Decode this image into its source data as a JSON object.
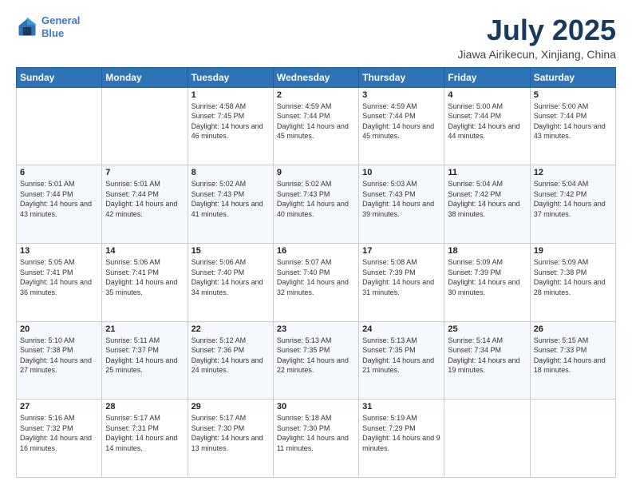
{
  "logo": {
    "line1": "General",
    "line2": "Blue"
  },
  "title": "July 2025",
  "subtitle": "Jiawa Airikecun, Xinjiang, China",
  "days": [
    "Sunday",
    "Monday",
    "Tuesday",
    "Wednesday",
    "Thursday",
    "Friday",
    "Saturday"
  ],
  "weeks": [
    [
      {
        "day": "",
        "sunrise": "",
        "sunset": "",
        "daylight": ""
      },
      {
        "day": "",
        "sunrise": "",
        "sunset": "",
        "daylight": ""
      },
      {
        "day": "1",
        "sunrise": "Sunrise: 4:58 AM",
        "sunset": "Sunset: 7:45 PM",
        "daylight": "Daylight: 14 hours and 46 minutes."
      },
      {
        "day": "2",
        "sunrise": "Sunrise: 4:59 AM",
        "sunset": "Sunset: 7:44 PM",
        "daylight": "Daylight: 14 hours and 45 minutes."
      },
      {
        "day": "3",
        "sunrise": "Sunrise: 4:59 AM",
        "sunset": "Sunset: 7:44 PM",
        "daylight": "Daylight: 14 hours and 45 minutes."
      },
      {
        "day": "4",
        "sunrise": "Sunrise: 5:00 AM",
        "sunset": "Sunset: 7:44 PM",
        "daylight": "Daylight: 14 hours and 44 minutes."
      },
      {
        "day": "5",
        "sunrise": "Sunrise: 5:00 AM",
        "sunset": "Sunset: 7:44 PM",
        "daylight": "Daylight: 14 hours and 43 minutes."
      }
    ],
    [
      {
        "day": "6",
        "sunrise": "Sunrise: 5:01 AM",
        "sunset": "Sunset: 7:44 PM",
        "daylight": "Daylight: 14 hours and 43 minutes."
      },
      {
        "day": "7",
        "sunrise": "Sunrise: 5:01 AM",
        "sunset": "Sunset: 7:44 PM",
        "daylight": "Daylight: 14 hours and 42 minutes."
      },
      {
        "day": "8",
        "sunrise": "Sunrise: 5:02 AM",
        "sunset": "Sunset: 7:43 PM",
        "daylight": "Daylight: 14 hours and 41 minutes."
      },
      {
        "day": "9",
        "sunrise": "Sunrise: 5:02 AM",
        "sunset": "Sunset: 7:43 PM",
        "daylight": "Daylight: 14 hours and 40 minutes."
      },
      {
        "day": "10",
        "sunrise": "Sunrise: 5:03 AM",
        "sunset": "Sunset: 7:43 PM",
        "daylight": "Daylight: 14 hours and 39 minutes."
      },
      {
        "day": "11",
        "sunrise": "Sunrise: 5:04 AM",
        "sunset": "Sunset: 7:42 PM",
        "daylight": "Daylight: 14 hours and 38 minutes."
      },
      {
        "day": "12",
        "sunrise": "Sunrise: 5:04 AM",
        "sunset": "Sunset: 7:42 PM",
        "daylight": "Daylight: 14 hours and 37 minutes."
      }
    ],
    [
      {
        "day": "13",
        "sunrise": "Sunrise: 5:05 AM",
        "sunset": "Sunset: 7:41 PM",
        "daylight": "Daylight: 14 hours and 36 minutes."
      },
      {
        "day": "14",
        "sunrise": "Sunrise: 5:06 AM",
        "sunset": "Sunset: 7:41 PM",
        "daylight": "Daylight: 14 hours and 35 minutes."
      },
      {
        "day": "15",
        "sunrise": "Sunrise: 5:06 AM",
        "sunset": "Sunset: 7:40 PM",
        "daylight": "Daylight: 14 hours and 34 minutes."
      },
      {
        "day": "16",
        "sunrise": "Sunrise: 5:07 AM",
        "sunset": "Sunset: 7:40 PM",
        "daylight": "Daylight: 14 hours and 32 minutes."
      },
      {
        "day": "17",
        "sunrise": "Sunrise: 5:08 AM",
        "sunset": "Sunset: 7:39 PM",
        "daylight": "Daylight: 14 hours and 31 minutes."
      },
      {
        "day": "18",
        "sunrise": "Sunrise: 5:09 AM",
        "sunset": "Sunset: 7:39 PM",
        "daylight": "Daylight: 14 hours and 30 minutes."
      },
      {
        "day": "19",
        "sunrise": "Sunrise: 5:09 AM",
        "sunset": "Sunset: 7:38 PM",
        "daylight": "Daylight: 14 hours and 28 minutes."
      }
    ],
    [
      {
        "day": "20",
        "sunrise": "Sunrise: 5:10 AM",
        "sunset": "Sunset: 7:38 PM",
        "daylight": "Daylight: 14 hours and 27 minutes."
      },
      {
        "day": "21",
        "sunrise": "Sunrise: 5:11 AM",
        "sunset": "Sunset: 7:37 PM",
        "daylight": "Daylight: 14 hours and 25 minutes."
      },
      {
        "day": "22",
        "sunrise": "Sunrise: 5:12 AM",
        "sunset": "Sunset: 7:36 PM",
        "daylight": "Daylight: 14 hours and 24 minutes."
      },
      {
        "day": "23",
        "sunrise": "Sunrise: 5:13 AM",
        "sunset": "Sunset: 7:35 PM",
        "daylight": "Daylight: 14 hours and 22 minutes."
      },
      {
        "day": "24",
        "sunrise": "Sunrise: 5:13 AM",
        "sunset": "Sunset: 7:35 PM",
        "daylight": "Daylight: 14 hours and 21 minutes."
      },
      {
        "day": "25",
        "sunrise": "Sunrise: 5:14 AM",
        "sunset": "Sunset: 7:34 PM",
        "daylight": "Daylight: 14 hours and 19 minutes."
      },
      {
        "day": "26",
        "sunrise": "Sunrise: 5:15 AM",
        "sunset": "Sunset: 7:33 PM",
        "daylight": "Daylight: 14 hours and 18 minutes."
      }
    ],
    [
      {
        "day": "27",
        "sunrise": "Sunrise: 5:16 AM",
        "sunset": "Sunset: 7:32 PM",
        "daylight": "Daylight: 14 hours and 16 minutes."
      },
      {
        "day": "28",
        "sunrise": "Sunrise: 5:17 AM",
        "sunset": "Sunset: 7:31 PM",
        "daylight": "Daylight: 14 hours and 14 minutes."
      },
      {
        "day": "29",
        "sunrise": "Sunrise: 5:17 AM",
        "sunset": "Sunset: 7:30 PM",
        "daylight": "Daylight: 14 hours and 13 minutes."
      },
      {
        "day": "30",
        "sunrise": "Sunrise: 5:18 AM",
        "sunset": "Sunset: 7:30 PM",
        "daylight": "Daylight: 14 hours and 11 minutes."
      },
      {
        "day": "31",
        "sunrise": "Sunrise: 5:19 AM",
        "sunset": "Sunset: 7:29 PM",
        "daylight": "Daylight: 14 hours and 9 minutes."
      },
      {
        "day": "",
        "sunrise": "",
        "sunset": "",
        "daylight": ""
      },
      {
        "day": "",
        "sunrise": "",
        "sunset": "",
        "daylight": ""
      }
    ]
  ]
}
